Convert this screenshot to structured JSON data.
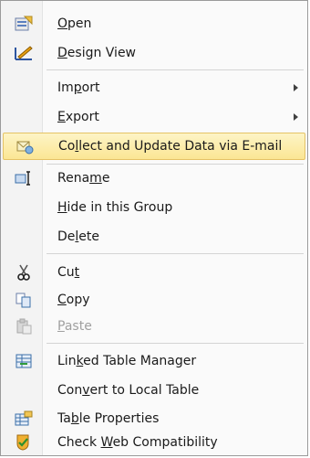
{
  "menu": {
    "items": [
      {
        "pre": "",
        "key": "O",
        "post": "pen",
        "icon": "open-folder-icon"
      },
      {
        "pre": "",
        "key": "D",
        "post": "esign View",
        "icon": "design-view-icon"
      },
      {
        "pre": "Im",
        "key": "p",
        "post": "ort",
        "icon": "",
        "submenu": true
      },
      {
        "pre": "",
        "key": "E",
        "post": "xport",
        "icon": "",
        "submenu": true
      },
      {
        "pre": "Co",
        "key": "l",
        "post": "lect and Update Data via E-mail",
        "icon": "collect-data-icon",
        "highlighted": true
      },
      {
        "pre": "Rena",
        "key": "m",
        "post": "e",
        "icon": "rename-icon"
      },
      {
        "pre": "",
        "key": "H",
        "post": "ide in this Group",
        "icon": ""
      },
      {
        "pre": "De",
        "key": "l",
        "post": "ete",
        "icon": ""
      },
      {
        "pre": "Cu",
        "key": "t",
        "post": "",
        "icon": "scissors-icon"
      },
      {
        "pre": "",
        "key": "C",
        "post": "opy",
        "icon": "copy-icon"
      },
      {
        "pre": "",
        "key": "P",
        "post": "aste",
        "icon": "paste-icon",
        "disabled": true
      },
      {
        "pre": "Lin",
        "key": "k",
        "post": "ed Table Manager",
        "icon": "linked-table-icon"
      },
      {
        "pre": "Con",
        "key": "v",
        "post": "ert to Local Table",
        "icon": ""
      },
      {
        "pre": "Ta",
        "key": "b",
        "post": "le Properties",
        "icon": "table-properties-icon"
      },
      {
        "pre": "Check ",
        "key": "W",
        "post": "eb Compatibility",
        "icon": "check-web-icon"
      }
    ]
  },
  "colors": {
    "highlight_top": "#fdf4c6",
    "highlight_bottom": "#fbe694",
    "highlight_border": "#e5c365",
    "disabled_text": "#a0a0a0"
  }
}
